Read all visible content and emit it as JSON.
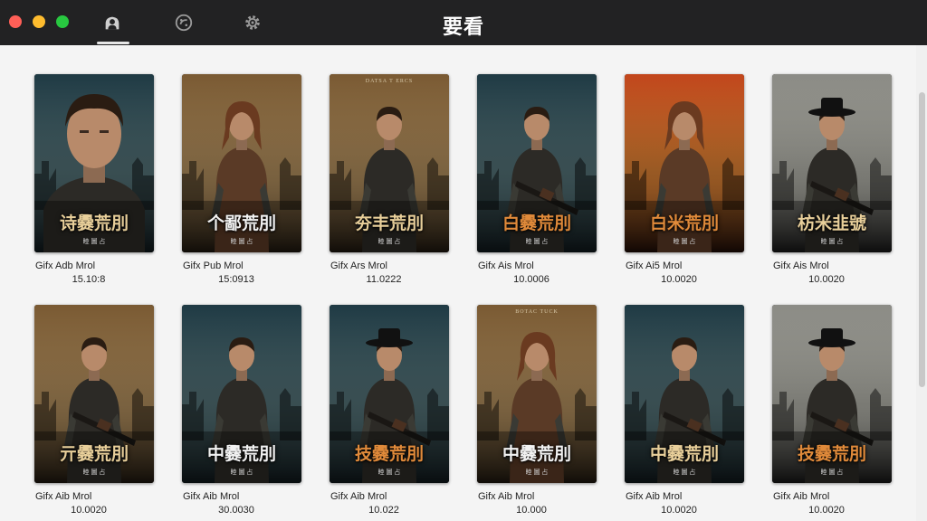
{
  "window": {
    "title": "要看",
    "tabs": [
      {
        "icon": "person-icon",
        "active": true
      },
      {
        "icon": "film-reel-icon",
        "active": false
      },
      {
        "icon": "gear-icon",
        "active": false
      }
    ]
  },
  "colors": {
    "titlebar": "#222223",
    "background": "#f4f4f4",
    "title_gold": "#e8cf9a",
    "title_orange": "#e08a3a"
  },
  "movies": [
    {
      "title": "Gifx Adb  Mrol",
      "sub": "15.10:8",
      "poster_title": "诗爨荒刖",
      "poster_sub": "睦 圖 占",
      "poster_top": "",
      "theme": "teal",
      "figure": "closeup",
      "title_color": "#e8cf9a"
    },
    {
      "title": "Gifx Pub  Mrol",
      "sub": "15:0913",
      "poster_title": "个鄙荒刖",
      "poster_sub": "睦 圖 占",
      "poster_top": "",
      "theme": "amber",
      "figure": "woman",
      "title_color": "#f2f2f2"
    },
    {
      "title": "Gifx Ars  Mrol",
      "sub": "11.0222",
      "poster_title": "夯丰荒刖",
      "poster_sub": "睦 圖 占",
      "poster_top": "DATSA T ERCS",
      "theme": "amber",
      "figure": "man",
      "title_color": "#e8cf9a"
    },
    {
      "title": "Gifx Ais  Mrol",
      "sub": "10.0006",
      "poster_title": "白爨荒刖",
      "poster_sub": "睦 圖 占",
      "poster_top": "",
      "theme": "teal",
      "figure": "gunman",
      "title_color": "#e08a3a"
    },
    {
      "title": "Gifx Ai5  Mrol",
      "sub": "10.0020",
      "poster_title": "白米荒刖",
      "poster_sub": "睦 圖 占",
      "poster_top": "",
      "theme": "fire",
      "figure": "woman",
      "title_color": "#e08a3a"
    },
    {
      "title": "Gifx Ais  Mrol",
      "sub": "10.0020",
      "poster_title": "枋米韭號",
      "poster_sub": "睦 圖 占",
      "poster_top": "",
      "theme": "storm",
      "figure": "hatgun",
      "title_color": "#e8cf9a"
    },
    {
      "title": "Gifx Aib  Mrol",
      "sub": "10.0020",
      "poster_title": "亓爨荒刖",
      "poster_sub": "睦 圖 占",
      "poster_top": "",
      "theme": "amber",
      "figure": "gunman",
      "title_color": "#e8cf9a"
    },
    {
      "title": "Gifx Aib  Mrol",
      "sub": "30.0030",
      "poster_title": "中爨荒刖",
      "poster_sub": "睦 圖 占",
      "poster_top": "",
      "theme": "teal",
      "figure": "man",
      "title_color": "#f2f2f2"
    },
    {
      "title": "Gifx Aib  Mrol",
      "sub": "10.022",
      "poster_title": "技爨荒刖",
      "poster_sub": "睦 圖 占",
      "poster_top": "",
      "theme": "teal",
      "figure": "hatgun",
      "title_color": "#e08a3a"
    },
    {
      "title": "Gifx Aib  Mrol",
      "sub": "10.000",
      "poster_title": "中爨荒刖",
      "poster_sub": "睦 圖 占",
      "poster_top": "BOTAC TUCK",
      "theme": "amber",
      "figure": "woman",
      "title_color": "#f2f2f2"
    },
    {
      "title": "Gifx Aib  Mrol",
      "sub": "10.0020",
      "poster_title": "中爨荒刖",
      "poster_sub": "睦 圖 占",
      "poster_top": "",
      "theme": "teal",
      "figure": "gunman",
      "title_color": "#e8cf9a"
    },
    {
      "title": "Gifx Aib  Mrol",
      "sub": "10.0020",
      "poster_title": "技爨荒刖",
      "poster_sub": "睦 圖 占",
      "poster_top": "",
      "theme": "storm",
      "figure": "hatgun",
      "title_color": "#e08a3a"
    }
  ]
}
